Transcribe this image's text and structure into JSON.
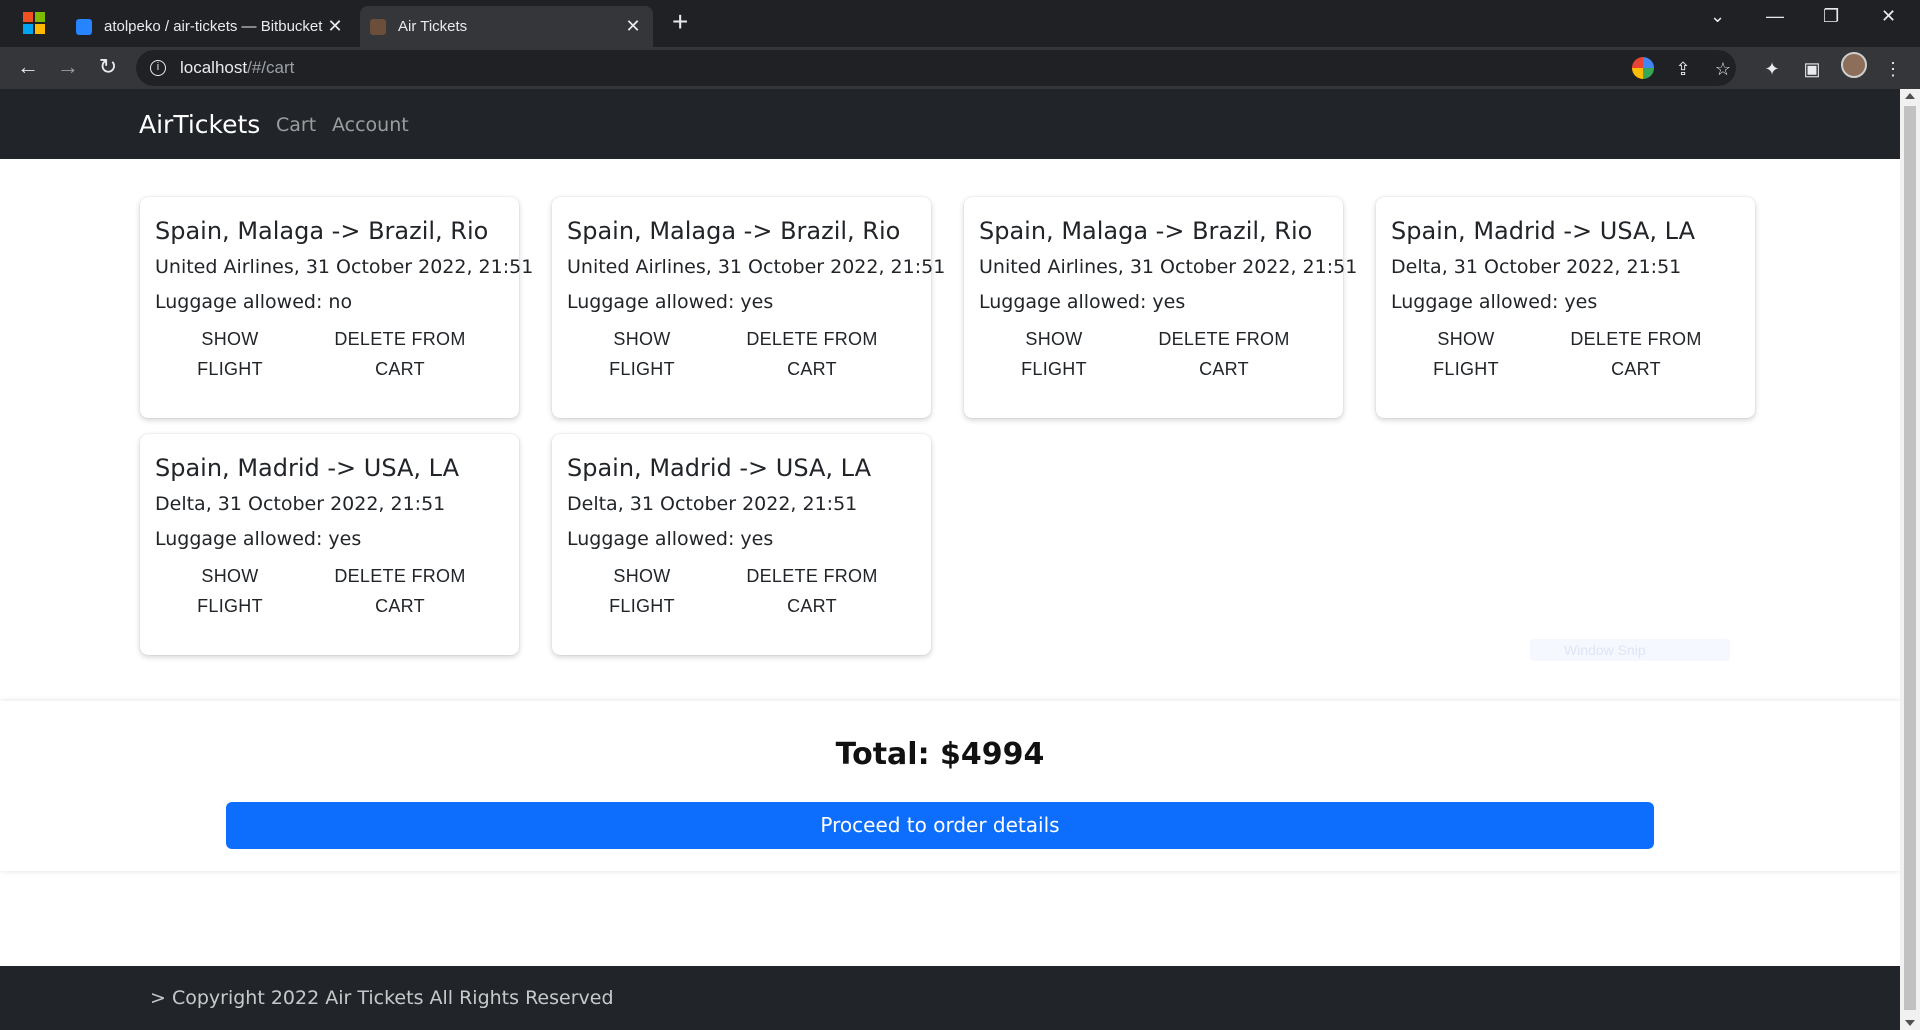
{
  "browser": {
    "tabs": [
      {
        "title": "atolpeko / air-tickets — Bitbucket",
        "active": false
      },
      {
        "title": "Air Tickets",
        "active": true
      }
    ],
    "url": {
      "host": "localhost",
      "path": "/#/cart"
    },
    "new_tab_symbol": "+",
    "window_controls": {
      "tab_search": "⌄",
      "minimize": "—",
      "restore": "❐",
      "close": "✕"
    }
  },
  "nav": {
    "brand": "AirTickets",
    "links": [
      "Cart",
      "Account"
    ]
  },
  "cards": [
    {
      "route": "Spain, Malaga -> Brazil, Rio",
      "meta": "United Airlines, 31 October 2022, 21:51",
      "luggage": "Luggage allowed: no",
      "show_label": "SHOW FLIGHT",
      "delete_label": "DELETE FROM CART"
    },
    {
      "route": "Spain, Malaga -> Brazil, Rio",
      "meta": "United Airlines, 31 October 2022, 21:51",
      "luggage": "Luggage allowed: yes",
      "show_label": "SHOW FLIGHT",
      "delete_label": "DELETE FROM CART"
    },
    {
      "route": "Spain, Malaga -> Brazil, Rio",
      "meta": "United Airlines, 31 October 2022, 21:51",
      "luggage": "Luggage allowed: yes",
      "show_label": "SHOW FLIGHT",
      "delete_label": "DELETE FROM CART"
    },
    {
      "route": "Spain, Madrid -> USA, LA",
      "meta": "Delta, 31 October 2022, 21:51",
      "luggage": "Luggage allowed: yes",
      "show_label": "SHOW FLIGHT",
      "delete_label": "DELETE FROM CART"
    },
    {
      "route": "Spain, Madrid -> USA, LA",
      "meta": "Delta, 31 October 2022, 21:51",
      "luggage": "Luggage allowed: yes",
      "show_label": "SHOW FLIGHT",
      "delete_label": "DELETE FROM CART"
    },
    {
      "route": "Spain, Madrid -> USA, LA",
      "meta": "Delta, 31 October 2022, 21:51",
      "luggage": "Luggage allowed: yes",
      "show_label": "SHOW FLIGHT",
      "delete_label": "DELETE FROM CART"
    }
  ],
  "summary": {
    "total": "Total: $4994",
    "proceed_label": "Proceed to order details"
  },
  "overlay": {
    "snip_label": "Window Snip"
  },
  "footer": {
    "copyright": "> Copyright 2022 Air Tickets All Rights Reserved"
  },
  "colors": {
    "navbar": "#212529",
    "primary": "#0d6efd",
    "chrome_dark": "#202124",
    "chrome_toolbar": "#35363a"
  }
}
